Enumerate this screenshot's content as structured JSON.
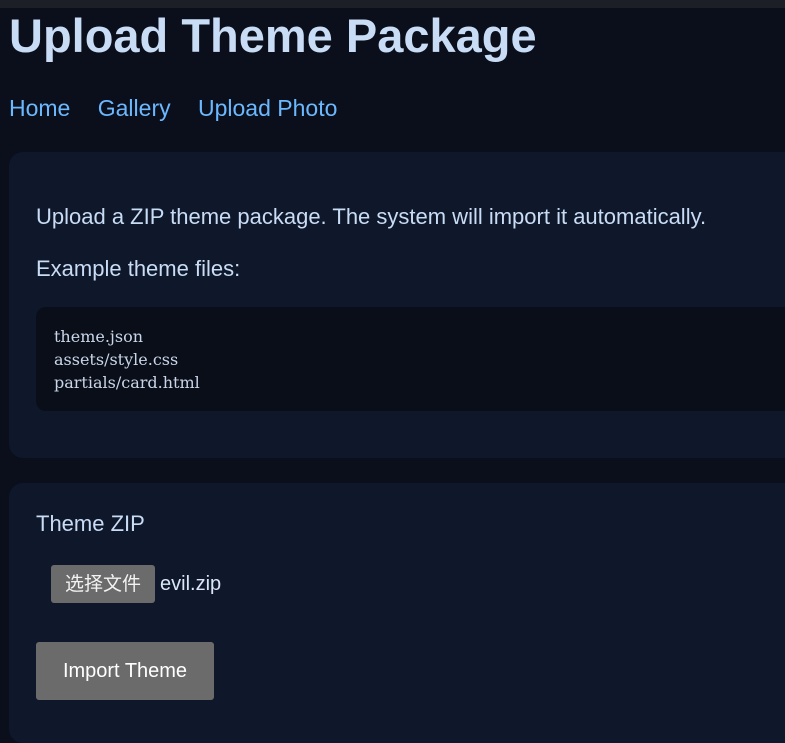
{
  "page": {
    "title": "Upload Theme Package"
  },
  "nav": {
    "items": [
      "Home",
      "Gallery",
      "Upload Photo"
    ]
  },
  "info": {
    "description": "Upload a ZIP theme package. The system will import it automatically.",
    "example_label": "Example theme files:",
    "example_files": [
      "theme.json",
      "assets/style.css",
      "partials/card.html"
    ]
  },
  "form": {
    "field_label": "Theme ZIP",
    "file_button_label": "选择文件",
    "selected_file": "evil.zip",
    "submit_label": "Import Theme"
  },
  "colors": {
    "background": "#0a0f1b",
    "card": "#0f172a",
    "link": "#6cb8ff",
    "button": "#6b6b6b"
  }
}
